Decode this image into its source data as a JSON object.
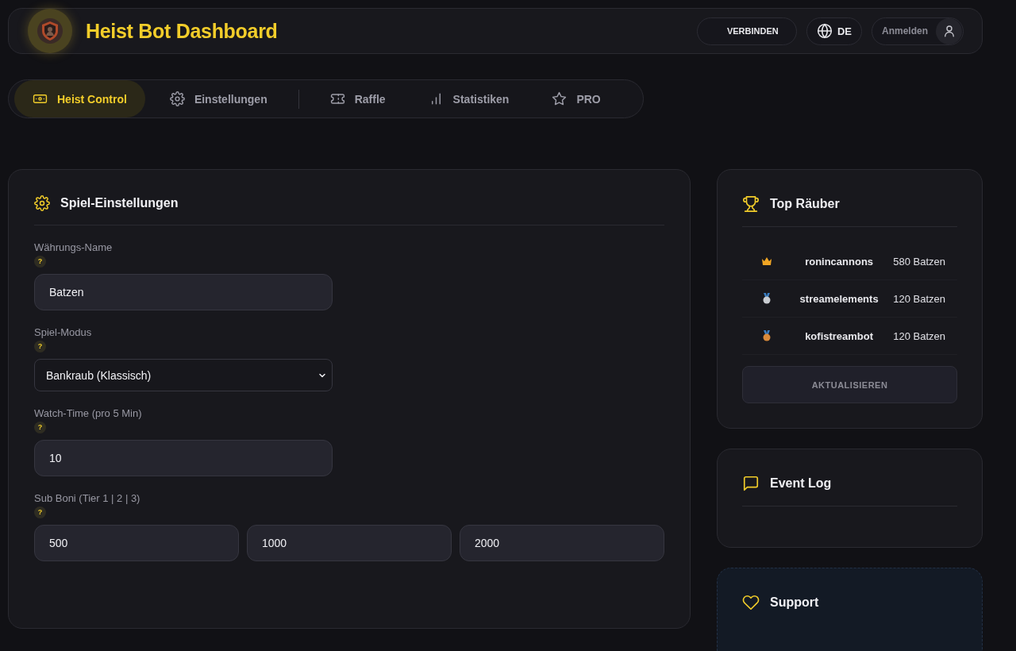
{
  "header": {
    "title": "Heist Bot Dashboard",
    "connect_button": "VERBINDEN",
    "language": "DE",
    "login": "Anmelden"
  },
  "tab_groups": [
    [
      {
        "label": "Heist Control",
        "selected": true
      },
      {
        "label": "Einstellungen",
        "selected": false
      }
    ],
    [
      {
        "label": "Raffle",
        "selected": false
      },
      {
        "label": "Statistiken",
        "selected": false
      },
      {
        "label": "PRO",
        "selected": false
      }
    ]
  ],
  "settings": {
    "title": "Spiel-Einstellungen",
    "fields": [
      {
        "kind": "text",
        "label": "Währungs-Name",
        "help": "?",
        "value": "Batzen"
      },
      {
        "kind": "select",
        "label": "Spiel-Modus",
        "help": "?",
        "value": "Bankraub (Klassisch)"
      },
      {
        "kind": "text",
        "label": "Watch-Time (pro 5 Min)",
        "help": "?",
        "value": "10"
      },
      {
        "kind": "multi",
        "label": "Sub Boni (Tier 1 | 2 | 3)",
        "help": "?",
        "values": [
          "500",
          "1000",
          "2000"
        ]
      }
    ]
  },
  "leaderboard": {
    "title": "Top Räuber",
    "rows": [
      {
        "name": "ronincannons",
        "amount": "580 Batzen"
      },
      {
        "name": "streamelements",
        "amount": "120 Batzen"
      },
      {
        "name": "kofistreambot",
        "amount": "120 Batzen"
      }
    ],
    "button": "AKTUALISIEREN"
  },
  "event_log": {
    "title": "Event Log"
  },
  "support": {
    "title": "Support"
  }
}
